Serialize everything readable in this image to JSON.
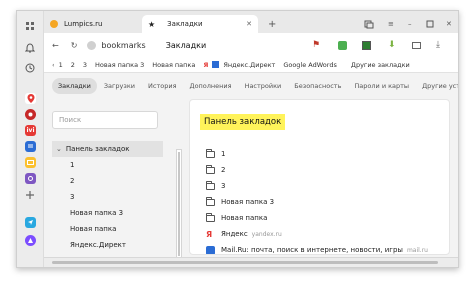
{
  "tabs": [
    {
      "label": "Lumpics.ru"
    },
    {
      "label": "Закладки"
    }
  ],
  "address": {
    "url_text": "bookmarks",
    "page_title": "Закладки"
  },
  "bookmarks_bar": [
    "1",
    "2",
    "3",
    "Новая папка 3",
    "Новая папка",
    "Яндекс.Директ",
    "Google AdWords",
    "Другие закладки"
  ],
  "settings_tabs": [
    "Закладки",
    "Загрузки",
    "История",
    "Дополнения",
    "Настройки",
    "Безопасность",
    "Пароли и карты",
    "Другие устройства"
  ],
  "search": {
    "placeholder": "Поиск"
  },
  "tree": [
    "Панель закладок",
    "1",
    "2",
    "3",
    "Новая папка 3",
    "Новая папка",
    "Яндекс.Директ"
  ],
  "panel_title": "Панель закладок",
  "items": [
    {
      "label": "1"
    },
    {
      "label": "2"
    },
    {
      "label": "3"
    },
    {
      "label": "Новая папка 3"
    },
    {
      "label": "Новая папка"
    },
    {
      "label": "Яндекс",
      "domain": "yandex.ru"
    },
    {
      "label": "Mail.Ru: почта, поиск в интернете, новости, игры",
      "domain": "mail.ru"
    }
  ],
  "sidebar_apps": [
    "ivi"
  ],
  "colors": {
    "highlight": "#fff35a",
    "accent_red": "#e53935",
    "accent_blue": "#2b6cd4"
  }
}
